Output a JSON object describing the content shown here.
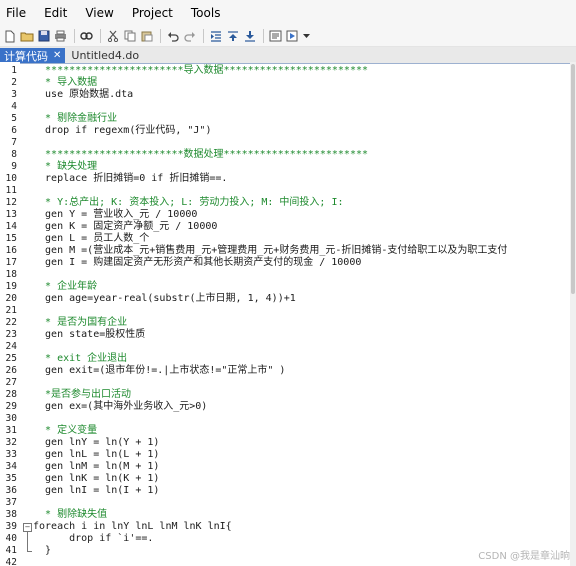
{
  "menu": [
    "File",
    "Edit",
    "View",
    "Project",
    "Tools"
  ],
  "toolbar_icons": [
    "new-file-icon",
    "open-folder-icon",
    "save-icon",
    "print-icon",
    "find-icon",
    "cut-icon",
    "copy-icon",
    "paste-icon",
    "undo-icon",
    "redo-icon",
    "indent-icon",
    "shift-up-icon",
    "shift-down-icon",
    "show-results-icon",
    "execute-do-icon",
    "dropdown-arrow-icon"
  ],
  "tabs": [
    {
      "label": "计算代码",
      "close": "✕",
      "active": true
    },
    {
      "label": "Untitled4.do",
      "active": false
    }
  ],
  "code": [
    {
      "n": "1",
      "t": "  ***********************导入数据************************",
      "c": "comment"
    },
    {
      "n": "2",
      "t": "  * 导入数据",
      "c": "comment"
    },
    {
      "n": "3",
      "t": "  use 原始数据.dta",
      "c": "code"
    },
    {
      "n": "4",
      "t": "",
      "c": "code"
    },
    {
      "n": "5",
      "t": "  * 剔除金融行业",
      "c": "comment"
    },
    {
      "n": "6",
      "t": "  drop if regexm(行业代码, \"J\")",
      "c": "code"
    },
    {
      "n": "7",
      "t": "",
      "c": "code"
    },
    {
      "n": "8",
      "t": "  ***********************数据处理************************",
      "c": "comment"
    },
    {
      "n": "9",
      "t": "  * 缺失处理",
      "c": "comment"
    },
    {
      "n": "10",
      "t": "  replace 折旧摊销=0 if 折旧摊销==.",
      "c": "code"
    },
    {
      "n": "11",
      "t": "",
      "c": "code"
    },
    {
      "n": "12",
      "t": "  * Y:总产出; K: 资本投入; L: 劳动力投入; M: 中间投入; I:",
      "c": "comment"
    },
    {
      "n": "13",
      "t": "  gen Y = 营业收入_元 / 10000",
      "c": "code"
    },
    {
      "n": "14",
      "t": "  gen K = 固定资产净额_元 / 10000",
      "c": "code"
    },
    {
      "n": "15",
      "t": "  gen L = 员工人数_个",
      "c": "code"
    },
    {
      "n": "16",
      "t": "  gen M =(营业成本_元+销售费用_元+管理费用_元+财务费用_元-折旧摊销-支付给职工以及为职工支付",
      "c": "code"
    },
    {
      "n": "17",
      "t": "  gen I = 购建固定资产无形资产和其他长期资产支付的现金 / 10000",
      "c": "code"
    },
    {
      "n": "18",
      "t": "",
      "c": "code"
    },
    {
      "n": "19",
      "t": "  * 企业年龄",
      "c": "comment"
    },
    {
      "n": "20",
      "t": "  gen age=year-real(substr(上市日期, 1, 4))+1",
      "c": "code"
    },
    {
      "n": "21",
      "t": "",
      "c": "code"
    },
    {
      "n": "22",
      "t": "  * 是否为国有企业",
      "c": "comment"
    },
    {
      "n": "23",
      "t": "  gen state=股权性质",
      "c": "code"
    },
    {
      "n": "24",
      "t": "",
      "c": "code"
    },
    {
      "n": "25",
      "t": "  * exit 企业退出",
      "c": "comment"
    },
    {
      "n": "26",
      "t": "  gen exit=(退市年份!=.|上市状态!=\"正常上市\" )",
      "c": "code"
    },
    {
      "n": "27",
      "t": "",
      "c": "code"
    },
    {
      "n": "28",
      "t": "  *是否参与出口活动",
      "c": "comment"
    },
    {
      "n": "29",
      "t": "  gen ex=(其中海外业务收入_元>0)",
      "c": "code"
    },
    {
      "n": "30",
      "t": "",
      "c": "code"
    },
    {
      "n": "31",
      "t": "  * 定义变量",
      "c": "comment"
    },
    {
      "n": "32",
      "t": "  gen lnY = ln(Y + 1)",
      "c": "code"
    },
    {
      "n": "33",
      "t": "  gen lnL = ln(L + 1)",
      "c": "code"
    },
    {
      "n": "34",
      "t": "  gen lnM = ln(M + 1)",
      "c": "code"
    },
    {
      "n": "35",
      "t": "  gen lnK = ln(K + 1)",
      "c": "code"
    },
    {
      "n": "36",
      "t": "  gen lnI = ln(I + 1)",
      "c": "code"
    },
    {
      "n": "37",
      "t": "",
      "c": "code"
    },
    {
      "n": "38",
      "t": "  * 剔除缺失值",
      "c": "comment"
    },
    {
      "n": "39",
      "t": "foreach i in lnY lnL lnM lnK lnI{",
      "c": "code"
    },
    {
      "n": "40",
      "t": "      drop if `i'==.",
      "c": "code"
    },
    {
      "n": "41",
      "t": "  }",
      "c": "code"
    },
    {
      "n": "42",
      "t": "",
      "c": "code"
    }
  ],
  "watermark": "CSDN @我是章汕晌"
}
